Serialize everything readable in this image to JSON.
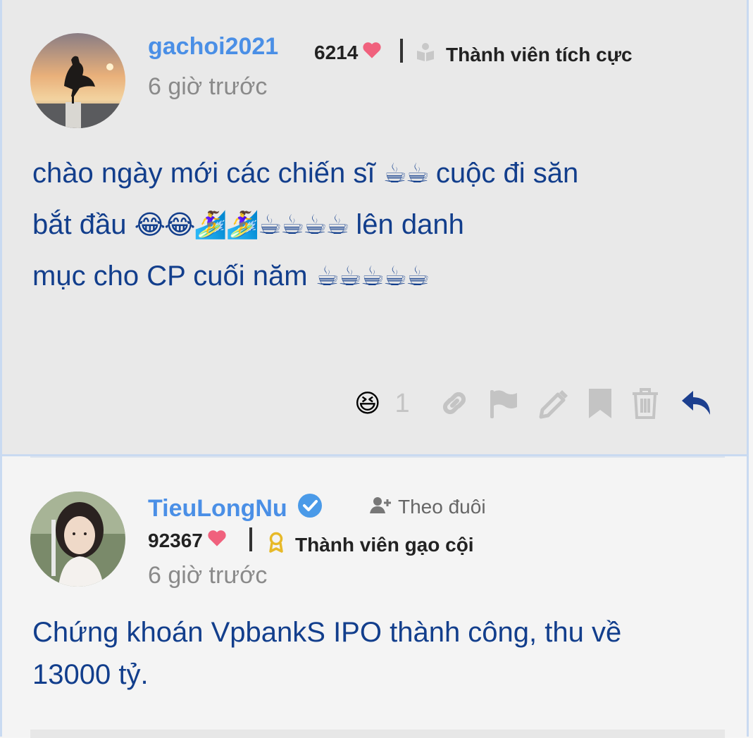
{
  "posts": [
    {
      "username": "gachoi2021",
      "score": "6214",
      "rank": "Thành viên tích cực",
      "time": "6 giờ trước",
      "content": {
        "line1_text": "chào ngày mới các chiến sĩ",
        "line1_emoji": "☕☕",
        "line1_tail": "cuộc đi săn",
        "line2_text": "bắt đầu",
        "line2_emoji": "😂😂🏄‍♀️🏄‍♀️☕☕☕☕",
        "line2_tail": "lên danh",
        "line3_text": "mục cho CP cuối năm",
        "line3_emoji": "☕☕☕☕☕"
      },
      "reaction_emoji": "😆",
      "reaction_count": "1"
    },
    {
      "username": "TieuLongNu",
      "follow_label": "Theo đuôi",
      "score": "92367",
      "rank": "Thành viên gạo cội",
      "time": "6 giờ trước",
      "content_line1": "Chứng khoán VpbankS IPO thành công, thu về",
      "content_line2": "13000 tỷ."
    }
  ],
  "colors": {
    "username": "#4a8fe6",
    "content": "#123e8c",
    "heart": "#f0617d",
    "reply": "#1c3f8f",
    "action_icon": "#c4c4c4"
  },
  "icons": [
    "heart-icon",
    "rank-book-icon",
    "rank-medal-icon",
    "verified-icon",
    "follow-user-icon",
    "link-icon",
    "flag-icon",
    "edit-icon",
    "bookmark-icon",
    "trash-icon",
    "reply-icon"
  ]
}
